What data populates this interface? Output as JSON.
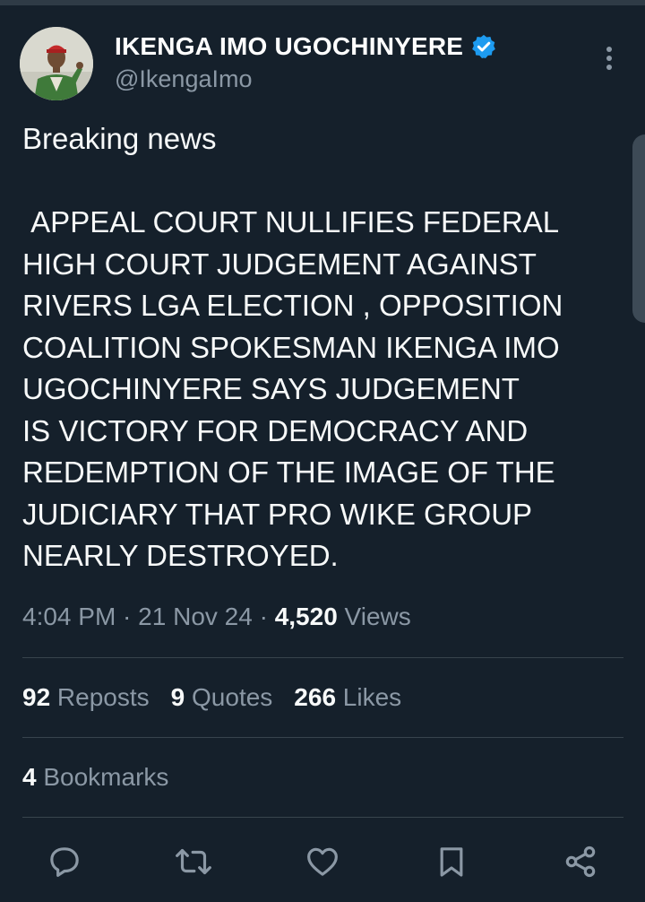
{
  "author": {
    "display_name": "IKENGA IMO UGOCHINYERE",
    "handle": "@IkengaImo",
    "verified": true
  },
  "tweet": {
    "text": "Breaking news\n\n APPEAL COURT NULLIFIES FEDERAL\nHIGH COURT JUDGEMENT AGAINST\nRIVERS LGA ELECTION , OPPOSITION\nCOALITION SPOKESMAN IKENGA IMO\nUGOCHINYERE SAYS JUDGEMENT\nIS VICTORY FOR DEMOCRACY AND\nREDEMPTION OF THE IMAGE OF THE\nJUDICIARY THAT PRO WIKE GROUP\nNEARLY DESTROYED."
  },
  "meta": {
    "time": "4:04 PM",
    "sep1": " · ",
    "date": "21 Nov 24",
    "sep2": " · ",
    "views_count": "4,520",
    "views_label": " Views"
  },
  "stats": {
    "reposts_count": "92",
    "reposts_label": " Reposts",
    "quotes_count": "9",
    "quotes_label": " Quotes",
    "likes_count": "266",
    "likes_label": " Likes"
  },
  "bookmarks": {
    "count": "4",
    "label": " Bookmarks"
  },
  "actions": {
    "icons": [
      "reply-icon",
      "repost-icon",
      "like-icon",
      "bookmark-icon",
      "share-icon"
    ]
  },
  "colors": {
    "background": "#15202b",
    "text": "#f7f9f9",
    "secondary_text": "#8b98a5",
    "divider": "#38444d",
    "verified": "#1d9bf0"
  }
}
